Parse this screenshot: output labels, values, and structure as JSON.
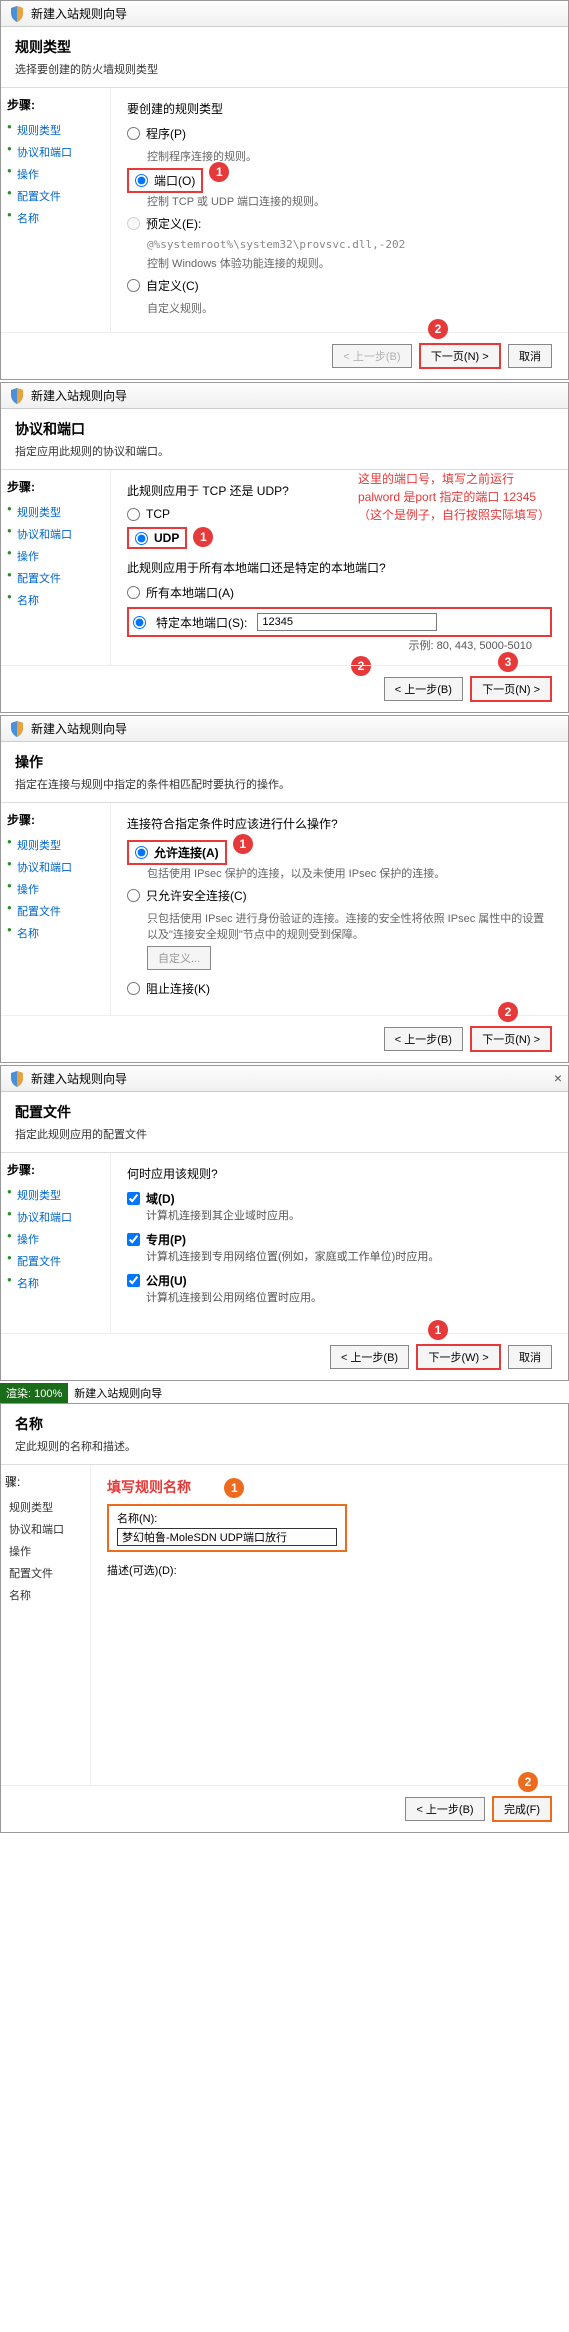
{
  "wizard_title": "新建入站规则向导",
  "steps_label": "步骤:",
  "steps": [
    "规则类型",
    "协议和端口",
    "操作",
    "配置文件",
    "名称"
  ],
  "buttons": {
    "back": "< 上一步(B)",
    "next": "下一页(N) >",
    "next_w": "下一步(W) >",
    "cancel": "取消",
    "finish": "完成(F)"
  },
  "panel1": {
    "title": "规则类型",
    "subtitle": "选择要创建的防火墙规则类型",
    "prompt": "要创建的规则类型",
    "opt_program": "程序(P)",
    "opt_program_desc": "控制程序连接的规则。",
    "opt_port": "端口(O)",
    "opt_port_desc": "控制 TCP 或 UDP 端口连接的规则。",
    "opt_predef": "预定义(E):",
    "opt_predef_val": "@%systemroot%\\system32\\provsvc.dll,-202",
    "opt_predef_desc": "控制 Windows 体验功能连接的规则。",
    "opt_custom": "自定义(C)",
    "opt_custom_desc": "自定义规则。"
  },
  "panel2": {
    "title": "协议和端口",
    "subtitle": "指定应用此规则的协议和端口。",
    "q1": "此规则应用于 TCP 还是 UDP?",
    "opt_tcp": "TCP",
    "opt_udp": "UDP",
    "q2": "此规则应用于所有本地端口还是特定的本地端口?",
    "opt_all": "所有本地端口(A)",
    "opt_spec": "特定本地端口(S):",
    "port_value": "12345",
    "port_example": "示例: 80, 443, 5000-5010",
    "annotation": "这里的端口号，填写之前运行 palword 是port 指定的端口 12345（这个是例子，自行按照实际填写）"
  },
  "panel3": {
    "title": "操作",
    "subtitle": "指定在连接与规则中指定的条件相匹配时要执行的操作。",
    "q": "连接符合指定条件时应该进行什么操作?",
    "opt_allow": "允许连接(A)",
    "opt_allow_desc": "包括使用 IPsec 保护的连接，以及未使用 IPsec 保护的连接。",
    "opt_secure": "只允许安全连接(C)",
    "opt_secure_desc": "只包括使用 IPsec 进行身份验证的连接。连接的安全性将依照 IPsec 属性中的设置以及\"连接安全规则\"节点中的规则受到保障。",
    "custom_btn": "自定义...",
    "opt_block": "阻止连接(K)"
  },
  "panel4": {
    "title": "配置文件",
    "subtitle": "指定此规则应用的配置文件",
    "q": "何时应用该规则?",
    "cb_domain": "域(D)",
    "cb_domain_desc": "计算机连接到其企业域时应用。",
    "cb_private": "专用(P)",
    "cb_private_desc": "计算机连接到专用网络位置(例如，家庭或工作单位)时应用。",
    "cb_public": "公用(U)",
    "cb_public_desc": "计算机连接到公用网络位置时应用。"
  },
  "panel5": {
    "title": "名称",
    "subtitle": "定此规则的名称和描述。",
    "anno": "填写规则名称",
    "name_label": "名称(N):",
    "name_value": "梦幻帕鲁-MoleSDN UDP端口放行",
    "desc_label": "描述(可选)(D):"
  },
  "progress": "渲染: 100%"
}
